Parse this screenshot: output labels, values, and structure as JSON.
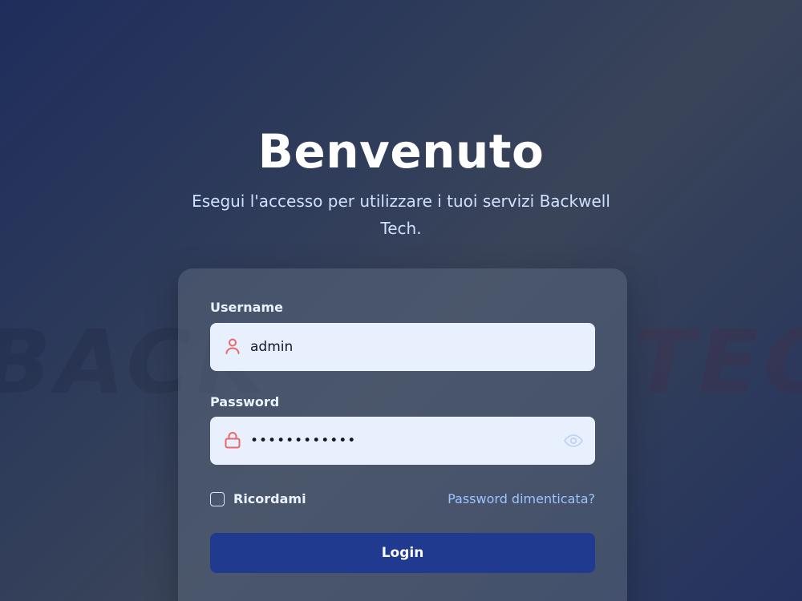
{
  "page": {
    "title": "Benvenuto",
    "subtitle": "Esegui l'accesso per utilizzare i tuoi servizi Backwell Tech."
  },
  "watermark": {
    "text": "BACKWELL TECH"
  },
  "form": {
    "username": {
      "label": "Username",
      "value": "admin",
      "icon": "user-icon"
    },
    "password": {
      "label": "Password",
      "value": "Password123!",
      "icon": "lock-icon",
      "toggle_icon": "eye-icon"
    },
    "remember_label": "Ricordami",
    "remember_checked": false,
    "forgot_label": "Password dimenticata?",
    "submit_label": "Login"
  },
  "colors": {
    "accent_button": "#1f3a8f",
    "input_background": "#e8f0fd",
    "icon_red": "#e8696b",
    "link": "#9ec4ff"
  }
}
